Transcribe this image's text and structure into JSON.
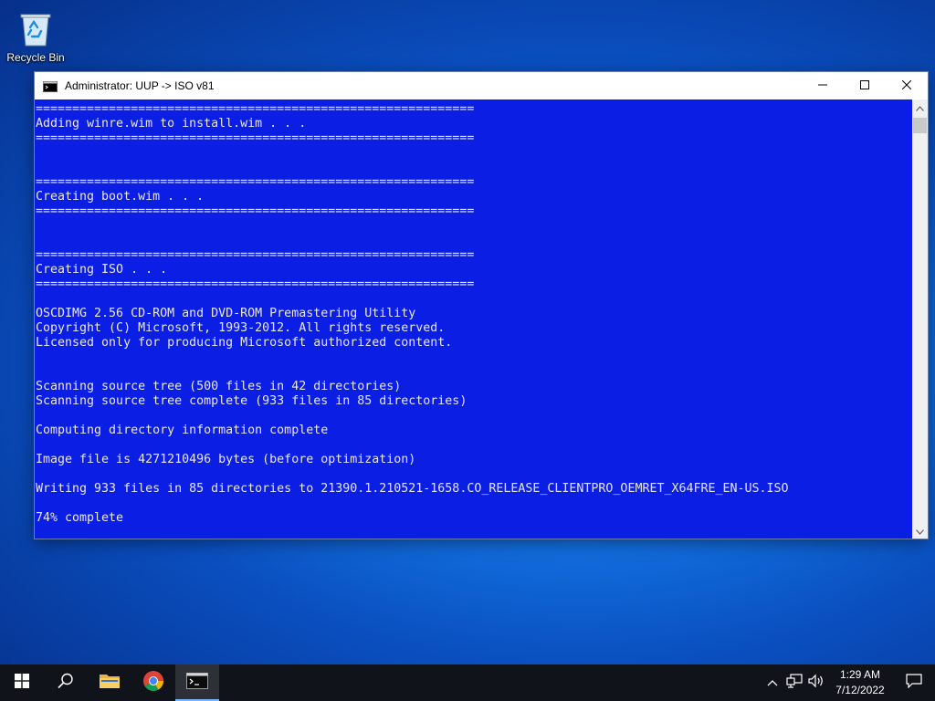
{
  "desktop": {
    "icons": [
      {
        "label": "Recycle Bin",
        "icon": "recycle-bin-icon"
      }
    ]
  },
  "window": {
    "title": "Administrator:  UUP -> ISO v81",
    "icon": "cmd-icon",
    "controls": {
      "minimize": "minimize-icon",
      "maximize": "maximize-icon",
      "close": "close-icon"
    },
    "console": {
      "background": "#0a1fe3",
      "foreground": "#e8e8e8",
      "lines": [
        "============================================================",
        "Adding winre.wim to install.wim . . .",
        "============================================================",
        "",
        "",
        "============================================================",
        "Creating boot.wim . . .",
        "============================================================",
        "",
        "",
        "============================================================",
        "Creating ISO . . .",
        "============================================================",
        "",
        "OSCDIMG 2.56 CD-ROM and DVD-ROM Premastering Utility",
        "Copyright (C) Microsoft, 1993-2012. All rights reserved.",
        "Licensed only for producing Microsoft authorized content.",
        "",
        "",
        "Scanning source tree (500 files in 42 directories)",
        "Scanning source tree complete (933 files in 85 directories)",
        "",
        "Computing directory information complete",
        "",
        "Image file is 4271210496 bytes (before optimization)",
        "",
        "Writing 933 files in 85 directories to 21390.1.210521-1658.CO_RELEASE_CLIENTPRO_OEMRET_X64FRE_EN-US.ISO",
        "",
        "74% complete"
      ]
    }
  },
  "taskbar": {
    "items": [
      {
        "name": "start-button",
        "icon": "windows-logo-icon"
      },
      {
        "name": "search-button",
        "icon": "search-icon"
      },
      {
        "name": "file-explorer-button",
        "icon": "folder-icon"
      },
      {
        "name": "chrome-button",
        "icon": "chrome-icon"
      },
      {
        "name": "cmd-taskbar-button",
        "icon": "cmd-icon",
        "active": true
      }
    ],
    "tray": {
      "icons": [
        "chevron-up-icon",
        "network-icon",
        "volume-icon"
      ],
      "time": "1:29 AM",
      "date": "7/12/2022",
      "notification_icon": "notification-icon"
    }
  }
}
